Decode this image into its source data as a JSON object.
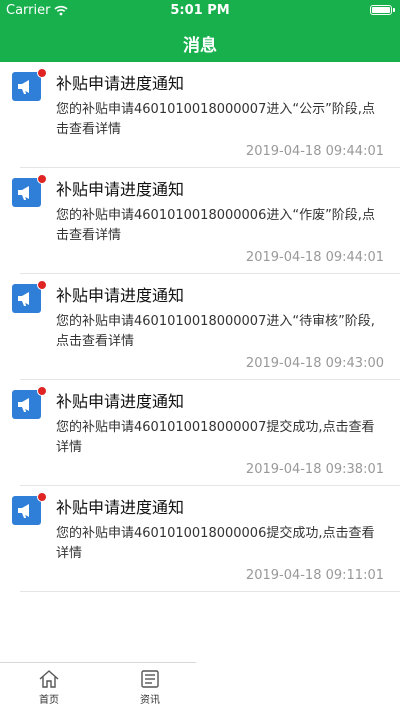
{
  "status_bar": {
    "carrier": "Carrier",
    "time": "5:01 PM"
  },
  "nav": {
    "title": "消息"
  },
  "messages": [
    {
      "title": "补贴申请进度通知",
      "body": "您的补贴申请4601010018000007进入“公示”阶段,点击查看详情",
      "time": "2019-04-18 09:44:01",
      "unread": true
    },
    {
      "title": "补贴申请进度通知",
      "body": "您的补贴申请4601010018000006进入“作废”阶段,点击查看详情",
      "time": "2019-04-18 09:44:01",
      "unread": true
    },
    {
      "title": "补贴申请进度通知",
      "body": "您的补贴申请4601010018000007进入“待审核”阶段,点击查看详情",
      "time": "2019-04-18 09:43:00",
      "unread": true
    },
    {
      "title": "补贴申请进度通知",
      "body": "您的补贴申请4601010018000007提交成功,点击查看详情",
      "time": "2019-04-18 09:38:01",
      "unread": true
    },
    {
      "title": "补贴申请进度通知",
      "body": "您的补贴申请4601010018000006提交成功,点击查看详情",
      "time": "2019-04-18 09:11:01",
      "unread": true
    }
  ],
  "message_icon": "megaphone-icon",
  "tabbar": {
    "tabs": [
      {
        "label": "首页",
        "icon": "home-icon"
      },
      {
        "label": "资讯",
        "icon": "news-icon"
      }
    ]
  },
  "colors": {
    "header": "#17b04d",
    "icon_bg": "#2f7fd9",
    "unread_dot": "#e02424",
    "time_text": "#999999"
  }
}
